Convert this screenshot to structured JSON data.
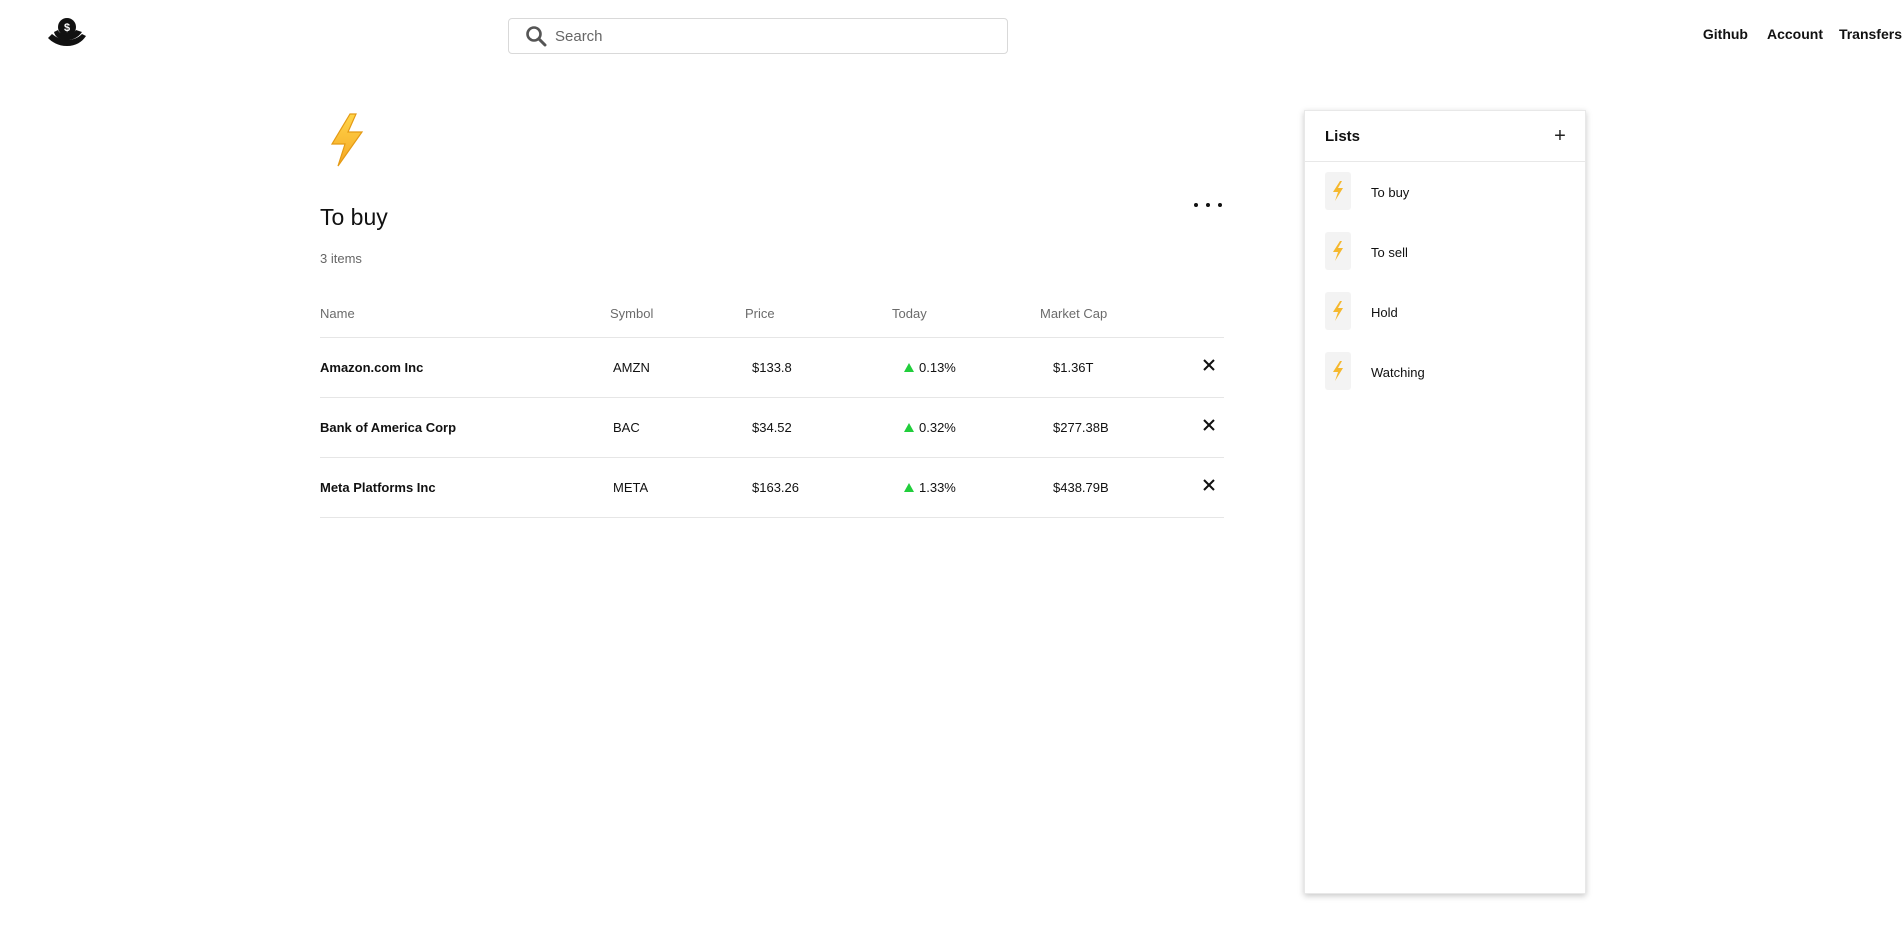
{
  "header": {
    "logo": "money-hand-logo",
    "search": {
      "placeholder": "Search",
      "value": ""
    },
    "nav": [
      "Github",
      "Account",
      "Transfers"
    ]
  },
  "list": {
    "emoji": "lightning-bolt-icon",
    "title": "To buy",
    "item_count": "3 items",
    "columns": [
      "Name",
      "Symbol",
      "Price",
      "Today",
      "Market Cap"
    ],
    "rows": [
      {
        "name": "Amazon.com Inc",
        "symbol": "AMZN",
        "price": "$133.8",
        "today": "0.13%",
        "market_cap": "$1.36T"
      },
      {
        "name": "Bank of America Corp",
        "symbol": "BAC",
        "price": "$34.52",
        "today": "0.32%",
        "market_cap": "$277.38B"
      },
      {
        "name": "Meta Platforms Inc",
        "symbol": "META",
        "price": "$163.26",
        "today": "1.33%",
        "market_cap": "$438.79B"
      }
    ]
  },
  "lists_panel": {
    "title": "Lists",
    "add_label": "+",
    "items": [
      "To buy",
      "To sell",
      "Hold",
      "Watching"
    ]
  },
  "colors": {
    "up": "#21ce3c",
    "bolt": "#f5b82e",
    "border": "#e6e6e6"
  }
}
